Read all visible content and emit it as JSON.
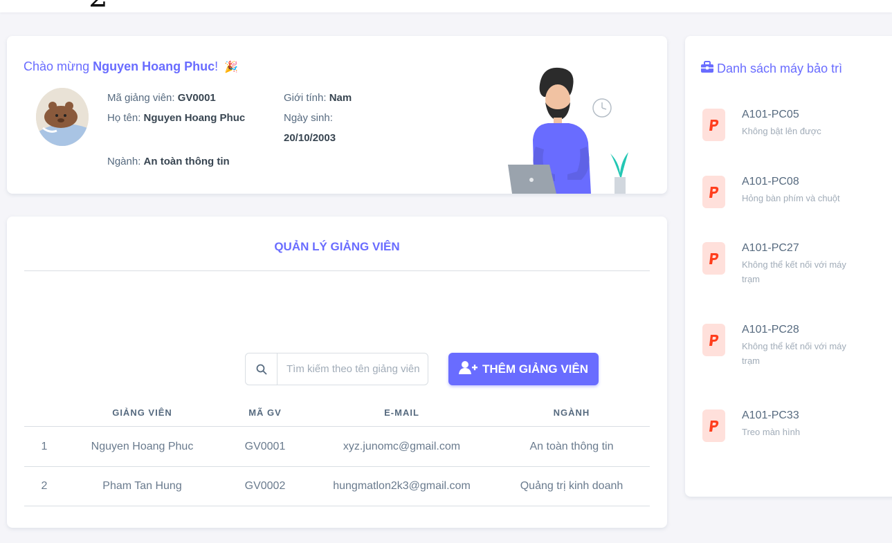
{
  "welcome": {
    "greeting_prefix": "Chào mừng ",
    "user_name": "Nguyen Hoang Phuc",
    "greeting_suffix": "!",
    "party_emoji": "🎉",
    "lecturer_id_label": "Mã giảng viên: ",
    "lecturer_id": "GV0001",
    "fullname_label": "Họ tên: ",
    "fullname": "Nguyen Hoang Phuc",
    "major_label": "Ngành: ",
    "major": "An toàn thông tin",
    "gender_label": "Giới tính: ",
    "gender": "Nam",
    "dob_label": "Ngày sinh:",
    "dob": "20/10/2003"
  },
  "management": {
    "title": "QUẢN LÝ GIẢNG VIÊN",
    "search_placeholder": "Tìm kiếm theo tên giảng viên",
    "add_button": "THÊM GIẢNG VIÊN",
    "columns": [
      "",
      "GIẢNG VIÊN",
      "MÃ GV",
      "E-MAIL",
      "NGÀNH"
    ],
    "rows": [
      {
        "no": "1",
        "name": "Nguyen Hoang Phuc",
        "code": "GV0001",
        "email": "xyz.junomc@gmail.com",
        "major": "An toàn thông tin"
      },
      {
        "no": "2",
        "name": "Pham Tan Hung",
        "code": "GV0002",
        "email": "hungmatlon2k3@gmail.com",
        "major": "Quảng trị kinh doanh"
      }
    ]
  },
  "maintenance": {
    "title": "Danh sách máy bảo trì",
    "items": [
      {
        "name": "A101-PC05",
        "desc": "Không bật lên được"
      },
      {
        "name": "A101-PC08",
        "desc": "Hỏng bàn phím và chuột"
      },
      {
        "name": "A101-PC27",
        "desc": "Không thể kết nối với máy trạm"
      },
      {
        "name": "A101-PC28",
        "desc": "Không thể kết nối với máy trạm"
      },
      {
        "name": "A101-PC33",
        "desc": "Treo màn hình"
      }
    ]
  },
  "icons": {
    "search": "search-icon",
    "add_user": "user-plus-icon",
    "toolbox": "toolbox-icon",
    "paypal": "paypal-icon"
  },
  "colors": {
    "primary": "#696cff",
    "danger_bg": "#ffe0db",
    "danger": "#ff3e1d",
    "background": "#f5f5f9"
  }
}
